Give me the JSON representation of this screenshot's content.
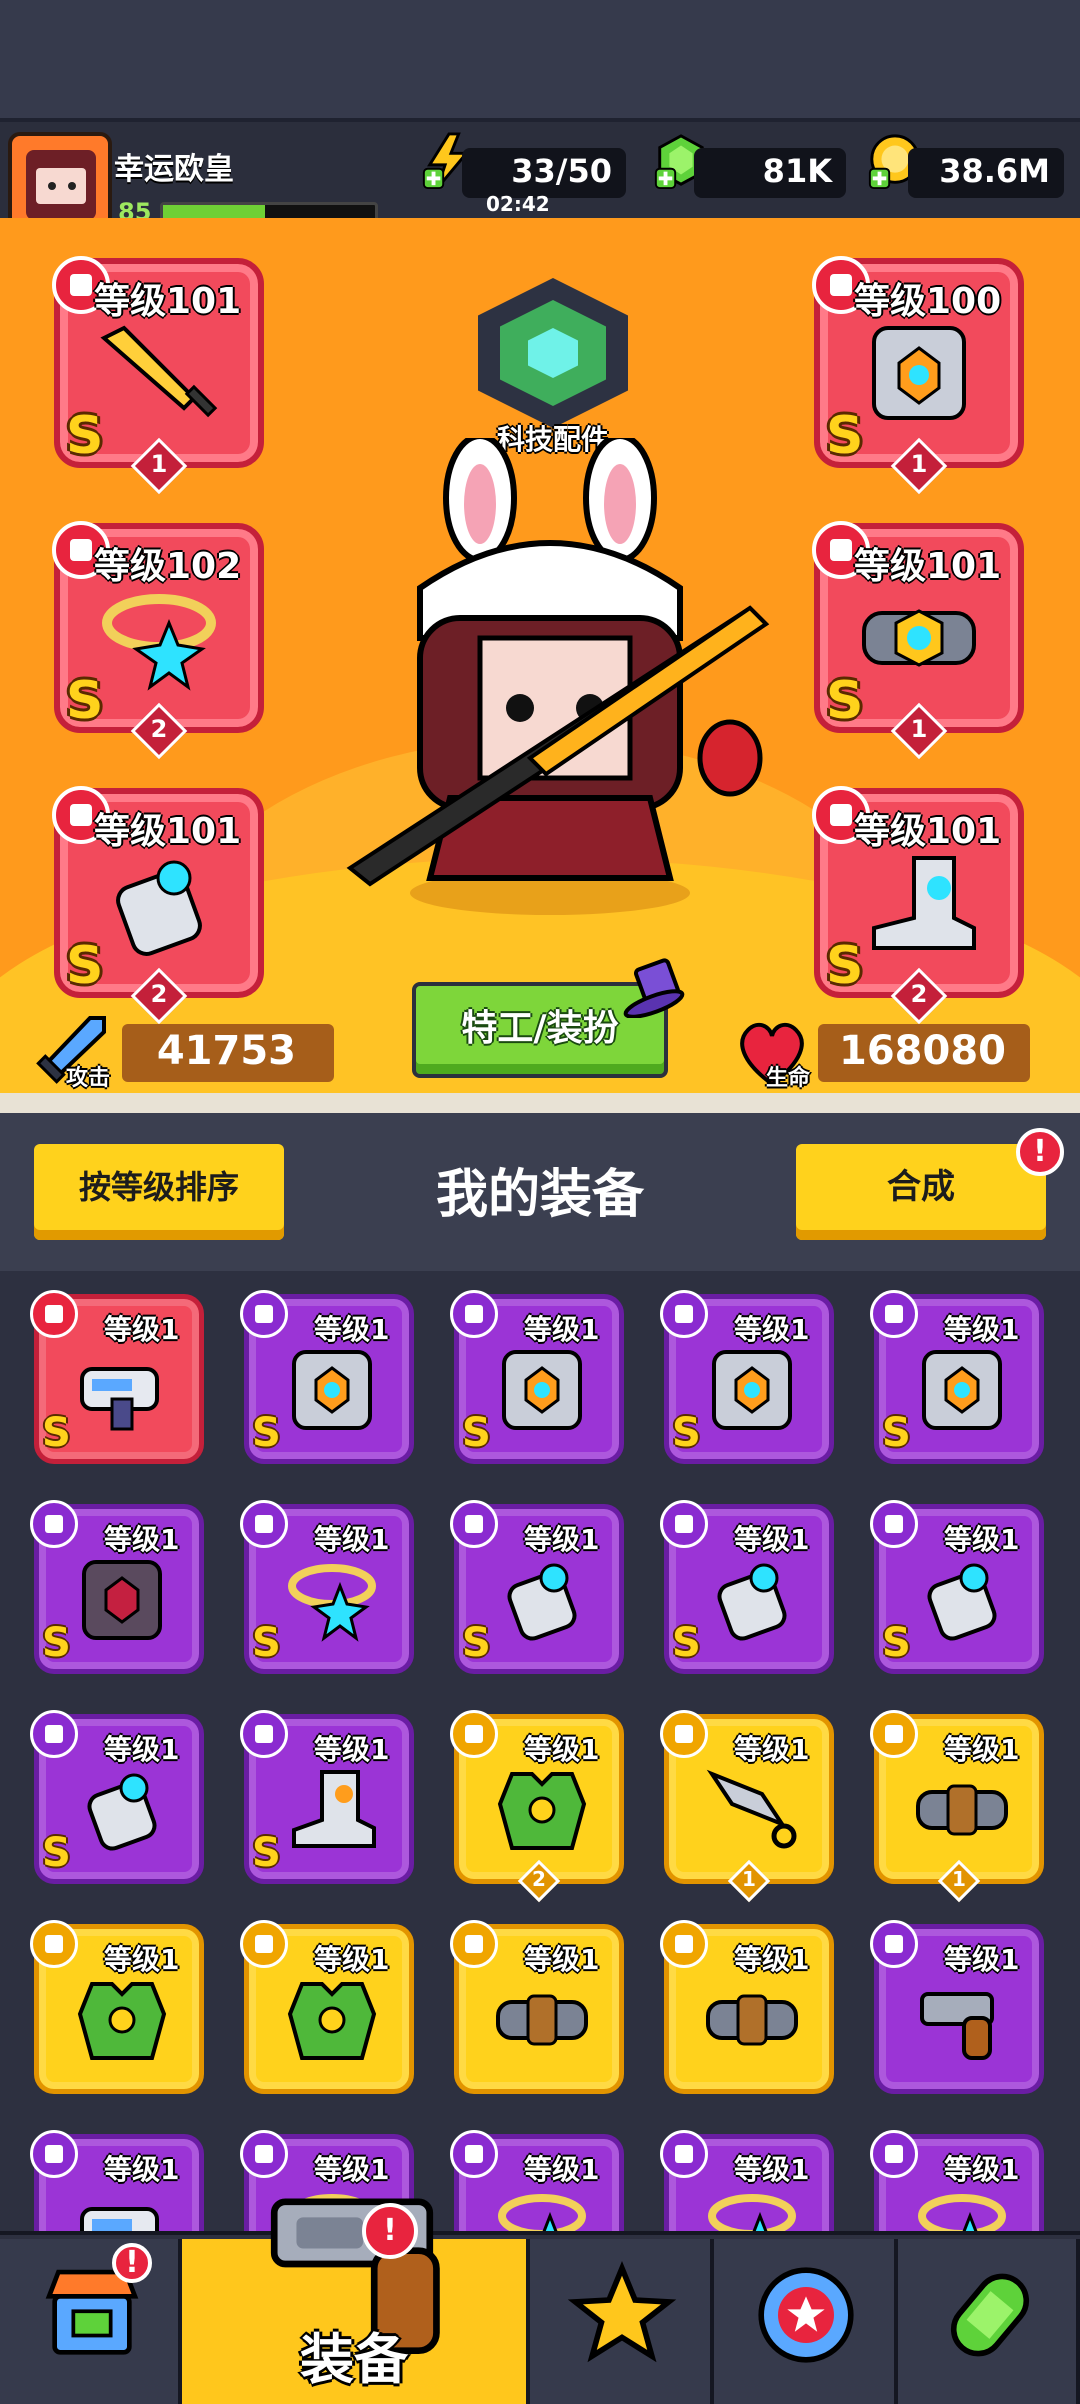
{
  "player": {
    "name": "幸运欧皇",
    "level": "85",
    "xp_fraction": 0.48
  },
  "resources": {
    "energy": {
      "value": "33/50",
      "timer": "02:42",
      "icon": "lightning-plus-icon"
    },
    "gems": {
      "value": "81K",
      "icon": "green-gem-plus-icon"
    },
    "gold": {
      "value": "38.6M",
      "icon": "gold-coin-plus-icon"
    }
  },
  "equipped": {
    "weapon": {
      "level": "等级101",
      "rank": "S",
      "stars": "1",
      "icon": "sword-icon"
    },
    "armor": {
      "level": "等级100",
      "rank": "S",
      "stars": "1",
      "icon": "armor-icon"
    },
    "necklace": {
      "level": "等级102",
      "rank": "S",
      "stars": "2",
      "icon": "necklace-icon"
    },
    "belt": {
      "level": "等级101",
      "rank": "S",
      "stars": "1",
      "icon": "belt-icon"
    },
    "gloves": {
      "level": "等级101",
      "rank": "S",
      "stars": "2",
      "icon": "glove-icon"
    },
    "boots": {
      "level": "等级101",
      "rank": "S",
      "stars": "2",
      "icon": "boot-icon"
    }
  },
  "tech": {
    "label": "科技配件"
  },
  "stats": {
    "attack_label": "攻击",
    "attack": "41753",
    "hp_label": "生命",
    "hp": "168080"
  },
  "agent_button": "特工/装扮",
  "inventory_header": {
    "sort": "按等级排序",
    "title": "我的装备",
    "merge": "合成",
    "merge_alert": "!"
  },
  "colors": {
    "red": "#f24a5c",
    "purple": "#9b34d6",
    "yellow": "#ffd21c",
    "accent_orange": "#ff9a1c"
  },
  "inventory": [
    {
      "level": "等级1",
      "tier": "red",
      "rank": "S",
      "icon": "blaster-icon"
    },
    {
      "level": "等级1",
      "tier": "purple",
      "rank": "S",
      "icon": "armor-icon"
    },
    {
      "level": "等级1",
      "tier": "purple",
      "rank": "S",
      "icon": "armor-icon"
    },
    {
      "level": "等级1",
      "tier": "purple",
      "rank": "S",
      "icon": "armor-icon"
    },
    {
      "level": "等级1",
      "tier": "purple",
      "rank": "S",
      "icon": "armor-icon"
    },
    {
      "level": "等级1",
      "tier": "purple",
      "rank": "S",
      "icon": "dark-armor-icon"
    },
    {
      "level": "等级1",
      "tier": "purple",
      "rank": "S",
      "icon": "necklace-icon"
    },
    {
      "level": "等级1",
      "tier": "purple",
      "rank": "S",
      "icon": "glove-icon"
    },
    {
      "level": "等级1",
      "tier": "purple",
      "rank": "S",
      "icon": "glove-icon"
    },
    {
      "level": "等级1",
      "tier": "purple",
      "rank": "S",
      "icon": "glove-icon"
    },
    {
      "level": "等级1",
      "tier": "purple",
      "rank": "S",
      "icon": "glove-icon"
    },
    {
      "level": "等级1",
      "tier": "purple",
      "rank": "S",
      "icon": "boot-icon"
    },
    {
      "level": "等级1",
      "tier": "yellow",
      "rank": "",
      "stars": "2",
      "icon": "green-vest-icon"
    },
    {
      "level": "等级1",
      "tier": "yellow",
      "rank": "",
      "stars": "1",
      "icon": "kunai-icon"
    },
    {
      "level": "等级1",
      "tier": "yellow",
      "rank": "",
      "stars": "1",
      "icon": "belt-icon"
    },
    {
      "level": "等级1",
      "tier": "yellow",
      "rank": "",
      "icon": "green-vest-icon"
    },
    {
      "level": "等级1",
      "tier": "yellow",
      "rank": "",
      "icon": "green-vest-icon"
    },
    {
      "level": "等级1",
      "tier": "yellow",
      "rank": "",
      "icon": "belt-icon"
    },
    {
      "level": "等级1",
      "tier": "yellow",
      "rank": "",
      "icon": "belt-icon"
    },
    {
      "level": "等级1",
      "tier": "purple",
      "rank": "",
      "icon": "revolver-icon"
    },
    {
      "level": "等级1",
      "tier": "purple",
      "rank": "",
      "icon": "blaster-icon"
    },
    {
      "level": "等级1",
      "tier": "purple",
      "rank": "",
      "icon": "necklace-icon"
    },
    {
      "level": "等级1",
      "tier": "purple",
      "rank": "",
      "icon": "necklace-icon"
    },
    {
      "level": "等级1",
      "tier": "purple",
      "rank": "",
      "icon": "necklace-icon"
    },
    {
      "level": "等级1",
      "tier": "purple",
      "rank": "",
      "icon": "necklace-icon"
    }
  ],
  "tabs": [
    {
      "icon": "shop-icon",
      "label": "",
      "alert": "!"
    },
    {
      "icon": "revolver-icon",
      "label": "装备",
      "alert": "!",
      "active": true
    },
    {
      "icon": "star-swords-icon",
      "label": ""
    },
    {
      "icon": "star-ball-icon",
      "label": ""
    },
    {
      "icon": "dna-capsule-icon",
      "label": ""
    }
  ]
}
